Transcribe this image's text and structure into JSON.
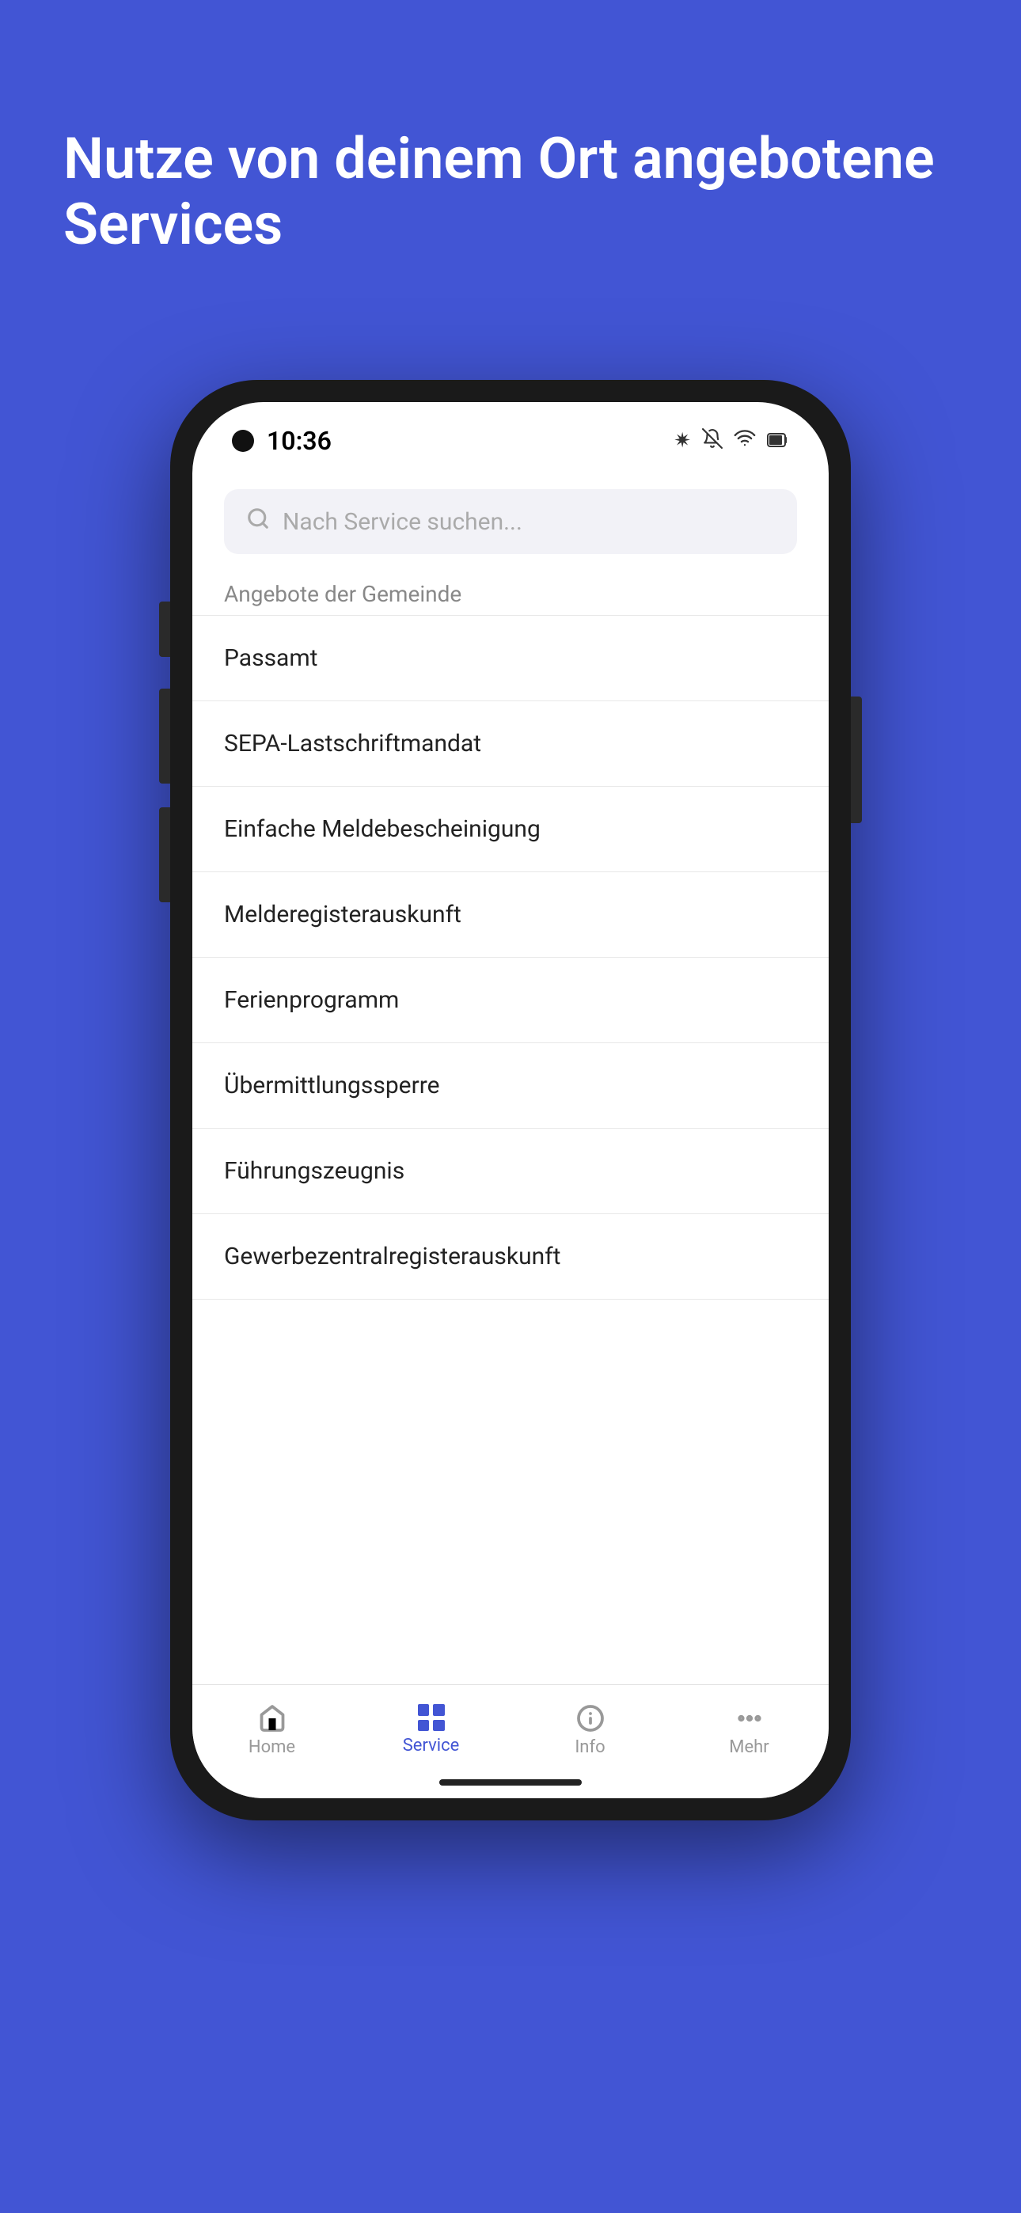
{
  "background_color": "#4255d4",
  "hero": {
    "title": "Nutze von deinem Ort angebotene Services"
  },
  "status_bar": {
    "time": "10:36",
    "icons": [
      "bluetooth",
      "bell-off",
      "wifi",
      "battery"
    ]
  },
  "search": {
    "placeholder": "Nach Service suchen..."
  },
  "section": {
    "label": "Angebote der Gemeinde"
  },
  "list_items": [
    {
      "id": 1,
      "label": "Passamt"
    },
    {
      "id": 2,
      "label": "SEPA-Lastschriftmandat"
    },
    {
      "id": 3,
      "label": "Einfache Meldebescheinigung"
    },
    {
      "id": 4,
      "label": "Melderegisterauskunft"
    },
    {
      "id": 5,
      "label": "Ferienprogramm"
    },
    {
      "id": 6,
      "label": "Übermittlungssperre"
    },
    {
      "id": 7,
      "label": "Führungszeugnis"
    },
    {
      "id": 8,
      "label": "Gewerbezentralregisterauskunft"
    }
  ],
  "bottom_nav": {
    "items": [
      {
        "id": "home",
        "label": "Home",
        "active": false
      },
      {
        "id": "service",
        "label": "Service",
        "active": true
      },
      {
        "id": "info",
        "label": "Info",
        "active": false
      },
      {
        "id": "mehr",
        "label": "Mehr",
        "active": false
      }
    ]
  }
}
